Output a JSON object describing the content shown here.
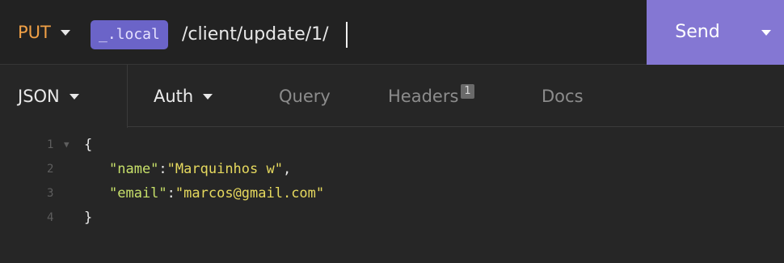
{
  "request": {
    "method": "PUT",
    "environment_tag": "_.local",
    "url_path": "/client/update/1/",
    "send_label": "Send"
  },
  "tabs": {
    "body_type": "JSON",
    "items": [
      {
        "label": "Auth"
      },
      {
        "label": "Query"
      },
      {
        "label": "Headers",
        "badge": "1"
      },
      {
        "label": "Docs"
      }
    ]
  },
  "editor": {
    "line_numbers": [
      "1",
      "2",
      "3",
      "4"
    ],
    "open_brace": "{",
    "close_brace": "}",
    "fields": [
      {
        "key": "\"name\"",
        "sep": ":",
        "value": "\"Marquinhos w\"",
        "trail": ","
      },
      {
        "key": "\"email\"",
        "sep": ":",
        "value": "\"marcos@gmail.com\"",
        "trail": ""
      }
    ]
  },
  "colors": {
    "method": "#f0a046",
    "send_button": "#8477d3",
    "env_tag": "#6b64c8",
    "json_key": "#c7e06a",
    "json_string": "#e6d95e"
  }
}
